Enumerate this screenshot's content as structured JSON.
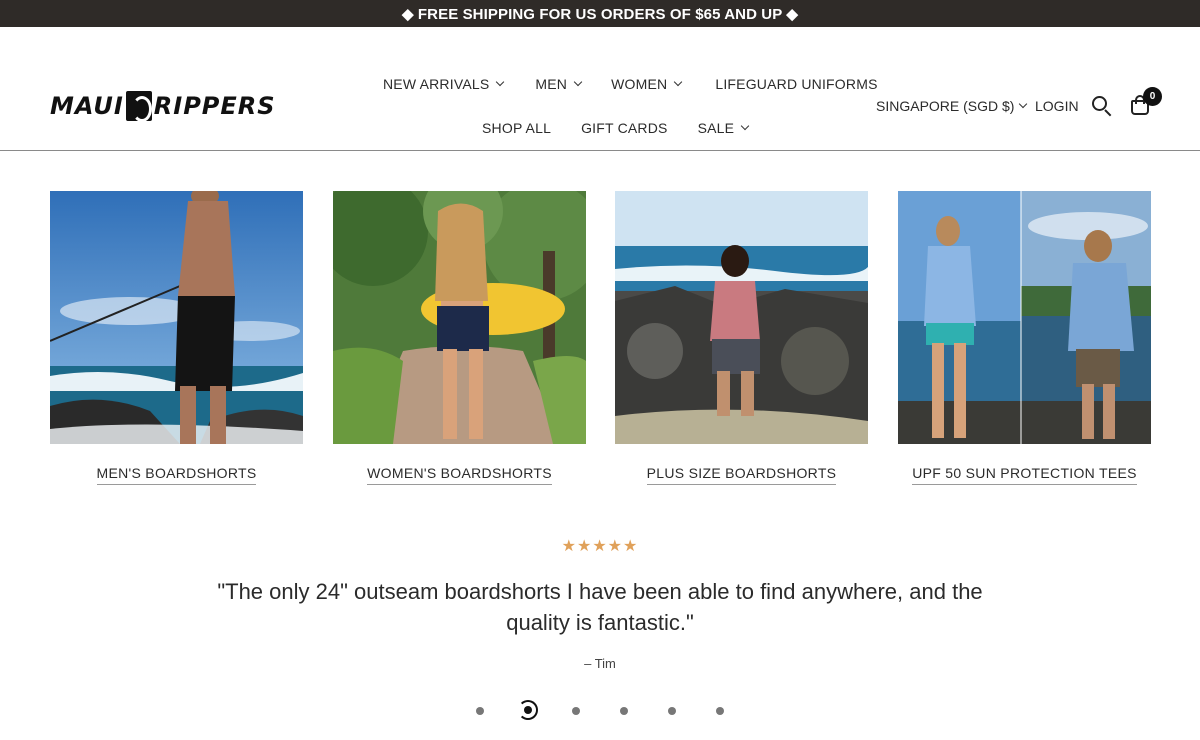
{
  "announcement": "◆ FREE SHIPPING FOR US ORDERS OF $65 AND UP ◆",
  "logo_text": {
    "left": "MAUI",
    "right": "RIPPERS"
  },
  "nav": {
    "row1": [
      "NEW ARRIVALS",
      "MEN",
      "WOMEN",
      "LIFEGUARD UNIFORMS"
    ],
    "row2": [
      "SHOP ALL",
      "GIFT CARDS",
      "SALE"
    ]
  },
  "tools": {
    "country": "SINGAPORE (SGD $)",
    "login": "LOGIN",
    "cart_count": "0",
    "icons": [
      "search-icon",
      "cart-icon",
      "chevron-down-icon"
    ]
  },
  "collections": [
    {
      "label": "MEN'S BOARDSHORTS"
    },
    {
      "label": "WOMEN'S BOARDSHORTS"
    },
    {
      "label": "PLUS SIZE BOARDSHORTS"
    },
    {
      "label": "UPF 50 SUN PROTECTION TEES"
    }
  ],
  "testimonial": {
    "stars": "★★★★★",
    "rating": 5,
    "quote": "\"The only 24\" outseam boardshorts I have been able to find anywhere, and the quality is fantastic.\"",
    "author": "–  Tim"
  },
  "carousel": {
    "total": 6,
    "active_index": 1
  },
  "colors": {
    "announcement_bg": "#2f2b28",
    "stars": "#e0a15a",
    "text": "#2b2b2b"
  }
}
